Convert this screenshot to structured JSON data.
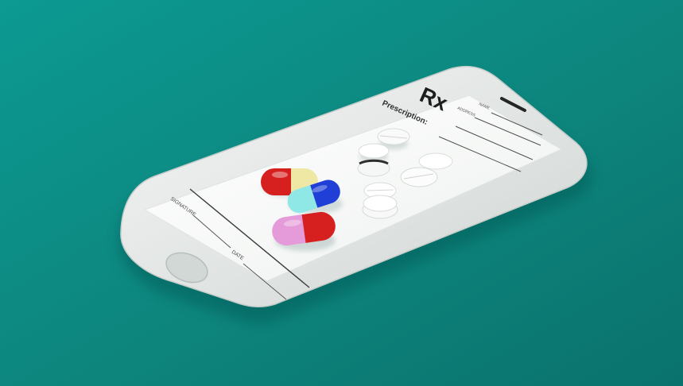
{
  "scene": {
    "background_color": "#0d8a82",
    "phone_body_color": "#e9ecea",
    "screen_color": "#f7f8f7",
    "rx_symbol": "Rx",
    "labels": {
      "prescription": "Prescription:",
      "name": "NAME",
      "address": "ADDRESS",
      "signature": "SIGNATURE",
      "date": "DATE"
    },
    "capsule_colors": [
      {
        "a": "#d61f1f",
        "b": "#efe7a4"
      },
      {
        "a": "#1f3fd6",
        "b": "#8fe7e6"
      },
      {
        "a": "#d61f1f",
        "b": "#e59ad9"
      }
    ],
    "pill_color": "#ffffff"
  }
}
